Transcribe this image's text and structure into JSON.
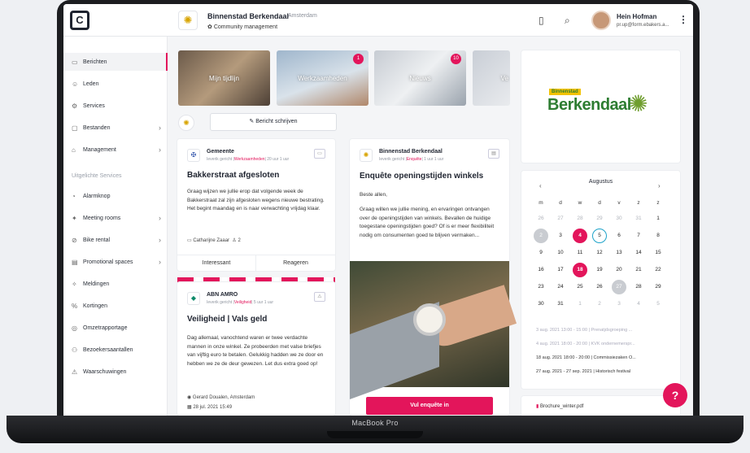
{
  "header": {
    "org_name": "Binnenstad Berkendaal",
    "org_location": "Amsterdam",
    "org_role": "Community management",
    "user_name": "Hein Hofman",
    "user_email": "pr.up@form.ebakers.a..."
  },
  "sidebar": {
    "items": [
      {
        "label": "Berichten",
        "icon": "message-icon"
      },
      {
        "label": "Leden",
        "icon": "users-icon"
      },
      {
        "label": "Services",
        "icon": "services-icon"
      },
      {
        "label": "Bestanden",
        "icon": "folder-icon"
      },
      {
        "label": "Management",
        "icon": "management-icon"
      }
    ],
    "group_label": "Uitgelichte Services",
    "services": [
      {
        "label": "Alarmknop",
        "icon": "alarm-icon"
      },
      {
        "label": "Meeting rooms",
        "icon": "meeting-icon"
      },
      {
        "label": "Bike rental",
        "icon": "bike-icon"
      },
      {
        "label": "Promotional spaces",
        "icon": "promo-icon"
      },
      {
        "label": "Meldingen",
        "icon": "bell-icon"
      },
      {
        "label": "Kortingen",
        "icon": "discount-icon"
      },
      {
        "label": "Omzetrapportage",
        "icon": "report-icon"
      },
      {
        "label": "Bezoekersaantallen",
        "icon": "visitors-icon"
      },
      {
        "label": "Waarschuwingen",
        "icon": "warning-icon"
      }
    ]
  },
  "tiles": [
    {
      "label": "Mijn tijdlijn",
      "badge": ""
    },
    {
      "label": "Werkzaamheden",
      "badge": "1"
    },
    {
      "label": "Nieuws",
      "badge": "10"
    },
    {
      "label": "Ve",
      "badge": ""
    }
  ],
  "compose_label": "Bericht schrijven",
  "posts": [
    {
      "author": "Gemeente",
      "meta_pre": "Ieverik gericht |",
      "meta_hl": "Werkzaamheden",
      "meta_post": "| 20 uur 1 uur",
      "title": "Bakkerstraat afgesloten",
      "body": "Graag wijzen we jullie erop dat volgende week de Bakkerstraat zal zijn afgesloten wegens nieuwe bestrating. Het begint maandag en is naar verwachting vrijdag klaar.",
      "footer_name": "Catharijne Zaaar",
      "footer_count": "2",
      "btn_interest": "Interessant",
      "btn_react": "Reageren"
    },
    {
      "author": "ABN AMRO",
      "meta_pre": "Ieverik gericht |",
      "meta_hl": "Veiligheid",
      "meta_post": "| 5 uur 1 uur",
      "title": "Veiligheid | Vals geld",
      "body": "Dag allemaal, vanochtend waren er twee verdachte mannen in onze winkel. Ze probeerden met valse briefjes van vijftig euro te betalen. Gelukkig hadden we ze door en hebben we ze de deur gewezen. Let dus extra goed op!",
      "footer_name": "Gerard Doualen, Amsterdam",
      "footer_date": "28 jul. 2021 15:49"
    },
    {
      "author": "Binnenstad Berkendaal",
      "meta_pre": "Ieverik gericht |",
      "meta_hl": "Enquête",
      "meta_post": "| 1 uur 1 uur",
      "title": "Enquête openingstijden winkels",
      "greeting": "Beste allen,",
      "body": "Graag willen we jullie mening, en ervaringen ontvangen over de openingstijden van winkels. Bevallen de huidige toegestane openingstijden goed? Of is er meer flexibiliteit nodig om consumenten goed te blijven vermaken...",
      "cta": "Vul enquête in"
    }
  ],
  "brand": {
    "tag": "Binnenstad",
    "name": "Berkendaal"
  },
  "calendar": {
    "month": "Augustus",
    "weekdays": [
      "m",
      "d",
      "w",
      "d",
      "v",
      "z",
      "z"
    ],
    "rows": [
      [
        "26",
        "27",
        "28",
        "29",
        "30",
        "31",
        "1"
      ],
      [
        "2",
        "3",
        "4",
        "5",
        "6",
        "7",
        "8"
      ],
      [
        "9",
        "10",
        "11",
        "12",
        "13",
        "14",
        "15"
      ],
      [
        "16",
        "17",
        "18",
        "19",
        "20",
        "21",
        "22"
      ],
      [
        "23",
        "24",
        "25",
        "26",
        "27",
        "28",
        "29"
      ],
      [
        "30",
        "31",
        "1",
        "2",
        "3",
        "4",
        "5"
      ]
    ],
    "events": [
      "3 aug. 2021 13:00 - 15:00 | Prenatjdsgroeping ...",
      "4 aug. 2021 18:00 - 20:00 | KVK ondernemerspr...",
      "18 aug. 2021 18:00 - 20:00 | Commissiezaken O...",
      "27 aug. 2021 - 27 sep. 2021 | Historisch festival"
    ],
    "attachment": "Brochure_winter.pdf"
  },
  "device_label": "MacBook Pro",
  "colors": {
    "accent": "#e3155b",
    "brand_green": "#2e7d32",
    "brand_yellow": "#f2c200"
  }
}
